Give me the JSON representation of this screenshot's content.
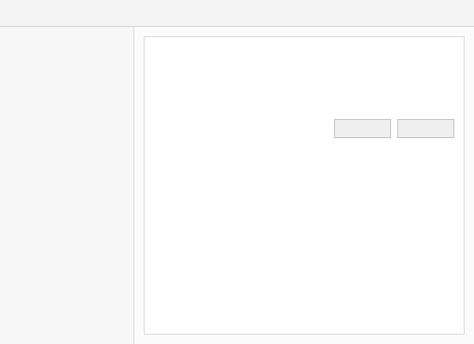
{
  "window": {
    "title": ""
  },
  "sidebar": {
    "items": []
  },
  "main": {
    "heading": ""
  },
  "footer": {
    "buttons": []
  }
}
